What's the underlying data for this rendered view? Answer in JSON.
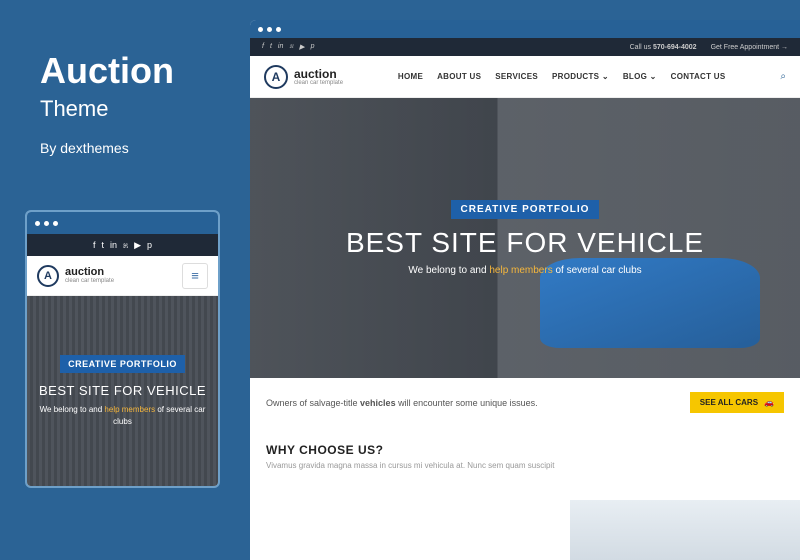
{
  "left": {
    "title": "Auction",
    "subtitle": "Theme",
    "byline": "By dexthemes"
  },
  "brand": {
    "name": "auction",
    "tagline": "clean car template",
    "mark": "A"
  },
  "topbar": {
    "callus_label": "Call us",
    "phone": "570-694-4002",
    "appointment": "Get Free Appointment →"
  },
  "menu": {
    "home": "HOME",
    "about": "ABOUT US",
    "services": "SERVICES",
    "products": "PRODUCTS",
    "blog": "BLOG",
    "contact": "CONTACT US"
  },
  "hero": {
    "badge": "CREATIVE PORTFOLIO",
    "title": "BEST SITE FOR VEHICLE",
    "sub_pre": "We belong to and ",
    "sub_highlight": "help members",
    "sub_post": " of several car clubs"
  },
  "strip": {
    "text_pre": "Owners of salvage-title ",
    "text_bold": "vehicles",
    "text_post": " will encounter some unique issues.",
    "cta": "SEE ALL CARS"
  },
  "why": {
    "heading": "WHY CHOOSE US?",
    "sub": "Vivamus gravida magna massa in cursus mi vehicula at. Nunc sem quam suscipit"
  },
  "icons": {
    "facebook": "f",
    "twitter": "t",
    "linkedin": "in",
    "rss": "೫",
    "youtube": "▶",
    "pinterest": "p",
    "search": "⌕",
    "burger": "≡",
    "car": "🚗"
  }
}
